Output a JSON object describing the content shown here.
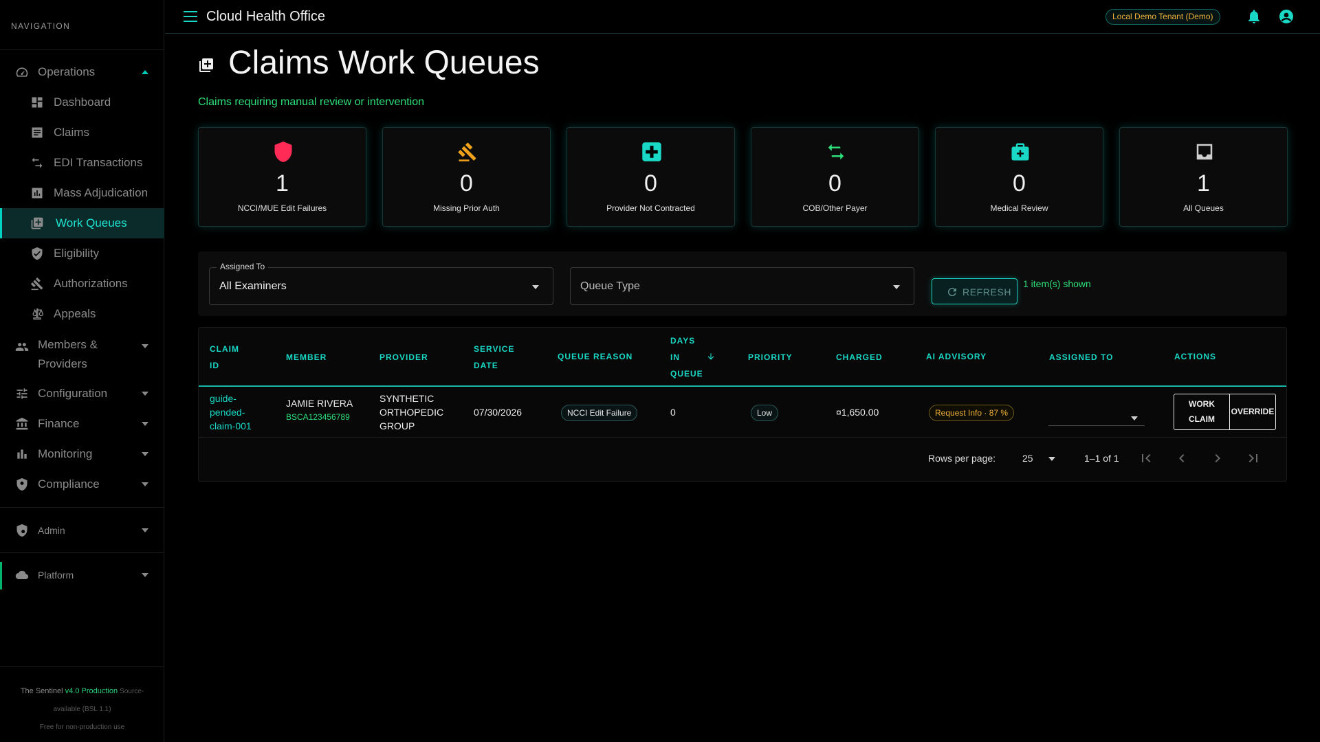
{
  "sidebar": {
    "heading": "NAVIGATION",
    "items": [
      {
        "label": "Operations"
      },
      {
        "label": "Dashboard"
      },
      {
        "label": "Claims"
      },
      {
        "label": "EDI Transactions"
      },
      {
        "label": "Mass Adjudication"
      },
      {
        "label": "Work Queues"
      },
      {
        "label": "Eligibility"
      },
      {
        "label": "Authorizations"
      },
      {
        "label": "Appeals"
      },
      {
        "label": "Members & Providers"
      },
      {
        "label": "Configuration"
      },
      {
        "label": "Finance"
      },
      {
        "label": "Monitoring"
      },
      {
        "label": "Compliance"
      },
      {
        "label": "Admin"
      },
      {
        "label": "Platform"
      }
    ],
    "footer": {
      "line1_prefix": "The Sentinel",
      "version": "v4.0 Production",
      "line1_suffix": "Source-",
      "line2": "available (BSL 1.1)",
      "line3": "Free for non-production use"
    }
  },
  "header": {
    "app_title": "Cloud Health Office",
    "tenant": "Local Demo Tenant (Demo)"
  },
  "page": {
    "title": "Claims Work Queues",
    "subtitle": "Claims requiring manual review or intervention"
  },
  "cards": [
    {
      "value": "1",
      "label": "NCCI/MUE Edit Failures",
      "icon": "shield-icon",
      "color": "#ff2a55"
    },
    {
      "value": "0",
      "label": "Missing Prior Auth",
      "icon": "gavel-icon",
      "color": "#f0a21c"
    },
    {
      "value": "0",
      "label": "Provider Not Contracted",
      "icon": "medical-plus-icon",
      "color": "#19d9c6"
    },
    {
      "value": "0",
      "label": "COB/Other Payer",
      "icon": "swap-arrows-icon",
      "color": "#2ee07a"
    },
    {
      "value": "0",
      "label": "Medical Review",
      "icon": "medical-bag-icon",
      "color": "#19d9c6"
    },
    {
      "value": "1",
      "label": "All Queues",
      "icon": "inbox-icon",
      "color": "#cfcfcf"
    }
  ],
  "filters": {
    "assigned_label": "Assigned To",
    "assigned_value": "All Examiners",
    "queue_type_placeholder": "Queue Type",
    "refresh_label": "REFRESH",
    "shown_text": "1 item(s) shown"
  },
  "table": {
    "headers": {
      "claim_id_1": "CLAIM",
      "claim_id_2": "ID",
      "member": "MEMBER",
      "provider": "PROVIDER",
      "service_1": "SERVICE",
      "service_2": "DATE",
      "queue_reason": "QUEUE REASON",
      "days_1": "DAYS",
      "days_2": "IN",
      "days_3": "QUEUE",
      "priority": "PRIORITY",
      "charged": "CHARGED",
      "ai": "AI ADVISORY",
      "assigned": "ASSIGNED TO",
      "actions": "ACTIONS"
    },
    "rows": [
      {
        "claim_1": "guide-",
        "claim_2": "pended-",
        "claim_3": "claim-001",
        "member_name": "JAMIE RIVERA",
        "member_id": "BSCA123456789",
        "provider_1": "SYNTHETIC",
        "provider_2": "ORTHOPEDIC",
        "provider_3": "GROUP",
        "service_date": "07/30/2026",
        "queue_reason": "NCCI Edit Failure",
        "days": "0",
        "priority": "Low",
        "charged": "¤1,650.00",
        "ai_advisory": "Request Info · 87 %",
        "action_work_1": "WORK",
        "action_work_2": "CLAIM",
        "action_override": "OVERRIDE"
      }
    ],
    "pagination": {
      "rows_label": "Rows per page:",
      "rows_value": "25",
      "range": "1–1 of 1"
    }
  },
  "colors": {
    "accent": "#19d9c6",
    "green": "#2ee07a",
    "warning": "#f0b23a"
  }
}
